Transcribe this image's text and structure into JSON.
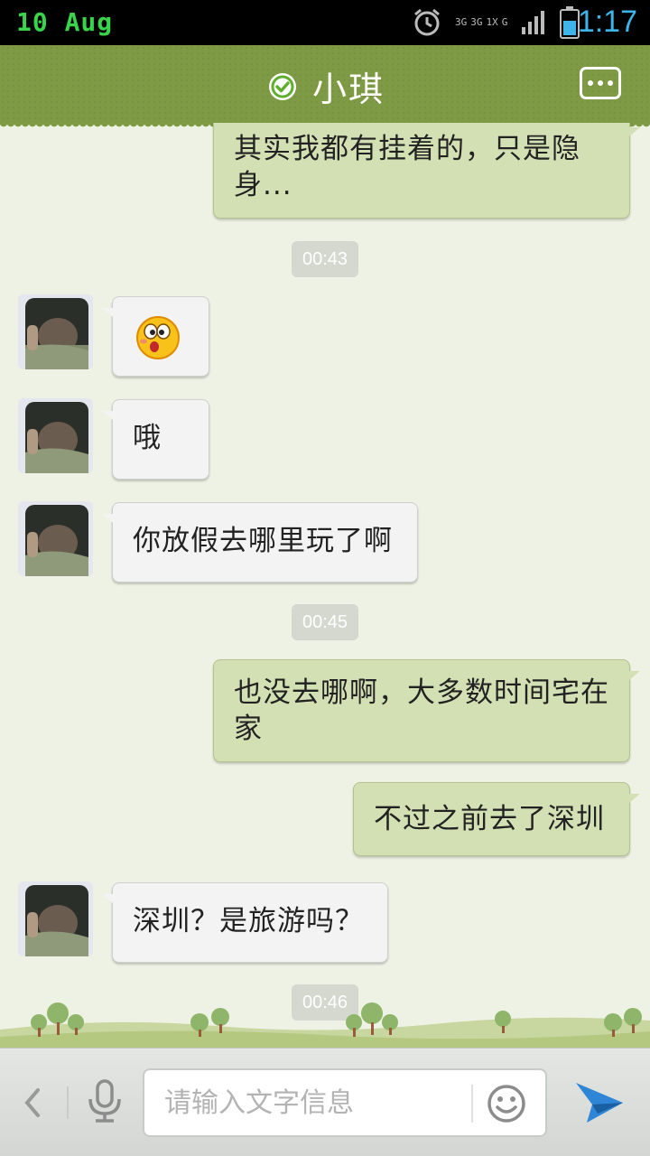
{
  "status_bar": {
    "date": "10 Aug",
    "time": "1:17",
    "network_labels": [
      "3G",
      "3G",
      "1X",
      "G"
    ]
  },
  "header": {
    "title": "小琪",
    "verified_icon": "check-circle-icon",
    "more_icon": "more-options-icon"
  },
  "messages": [
    {
      "type": "outgoing",
      "text": "其实我都有挂着的，只是隐身..."
    },
    {
      "type": "time",
      "text": "00:43"
    },
    {
      "type": "incoming",
      "content": "surprised-emoji",
      "text": ""
    },
    {
      "type": "incoming",
      "text": "哦"
    },
    {
      "type": "incoming",
      "text": "你放假去哪里玩了啊"
    },
    {
      "type": "time",
      "text": "00:45"
    },
    {
      "type": "outgoing",
      "text": "也没去哪啊，大多数时间宅在家"
    },
    {
      "type": "outgoing",
      "text": "不过之前去了深圳"
    },
    {
      "type": "incoming",
      "text": "深圳？是旅游吗？"
    },
    {
      "type": "time",
      "text": "00:46"
    }
  ],
  "composer": {
    "placeholder": "请输入文字信息",
    "back_icon": "chevron-left-icon",
    "mic_icon": "microphone-icon",
    "emoji_icon": "smiley-icon",
    "send_icon": "send-icon"
  },
  "colors": {
    "header": "#7e9a44",
    "outgoing_bubble": "#d3e0b4",
    "incoming_bubble": "#f3f3f3",
    "status_time": "#3fb4e8",
    "status_date": "#39d44a",
    "send": "#2f86d6"
  }
}
